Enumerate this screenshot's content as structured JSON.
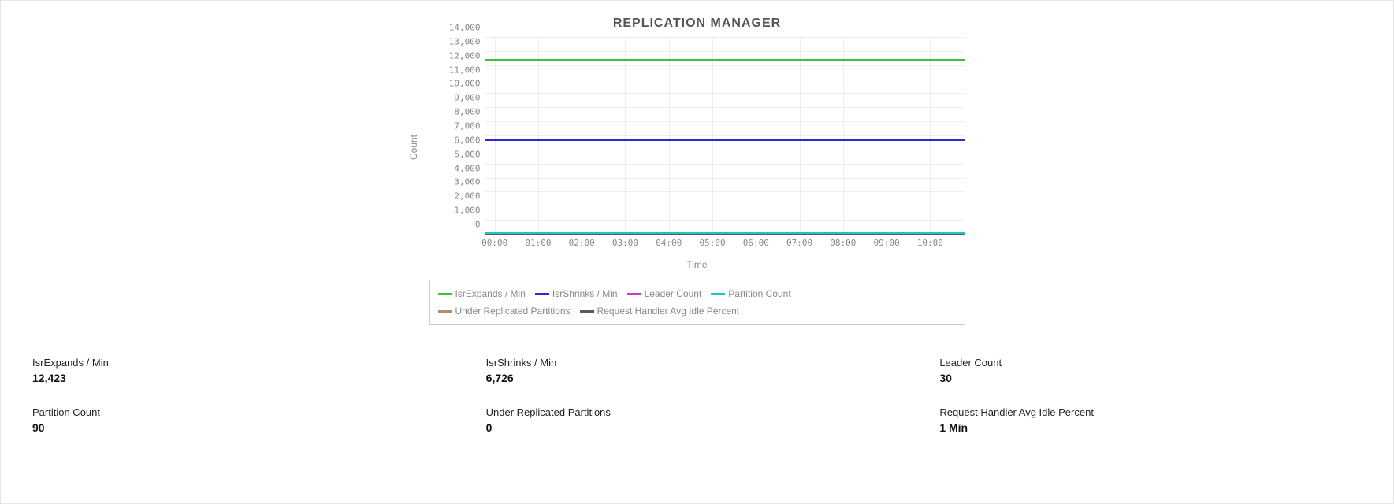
{
  "title": "REPLICATION MANAGER",
  "ylabel": "Count",
  "xlabel": "Time",
  "yticks": [
    "0",
    "1,000",
    "2,000",
    "3,000",
    "4,000",
    "5,000",
    "6,000",
    "7,000",
    "8,000",
    "9,000",
    "10,000",
    "11,000",
    "12,000",
    "13,000",
    "14,000"
  ],
  "xticks": [
    "00:00",
    "01:00",
    "02:00",
    "03:00",
    "04:00",
    "05:00",
    "06:00",
    "07:00",
    "08:00",
    "09:00",
    "10:00"
  ],
  "legend": [
    {
      "name": "IsrExpands / Min",
      "color": "#3fbf3f"
    },
    {
      "name": "IsrShrinks / Min",
      "color": "#2a2ad4"
    },
    {
      "name": "Leader Count",
      "color": "#d633c2"
    },
    {
      "name": "Partition Count",
      "color": "#20c6c6"
    },
    {
      "name": "Under Replicated Partitions",
      "color": "#b88b70"
    },
    {
      "name": "Request Handler Avg Idle Percent",
      "color": "#5a5a5a"
    }
  ],
  "stats": [
    {
      "label": "IsrExpands / Min",
      "value": "12,423"
    },
    {
      "label": "IsrShrinks / Min",
      "value": "6,726"
    },
    {
      "label": "Leader Count",
      "value": "30"
    },
    {
      "label": "Partition Count",
      "value": "90"
    },
    {
      "label": "Under Replicated Partitions",
      "value": "0"
    },
    {
      "label": "Request Handler Avg Idle Percent",
      "value": "1 Min"
    }
  ],
  "chart_data": {
    "type": "line",
    "title": "REPLICATION MANAGER",
    "xlabel": "Time",
    "ylabel": "Count",
    "ylim": [
      0,
      14000
    ],
    "x": [
      "00:00",
      "01:00",
      "02:00",
      "03:00",
      "04:00",
      "05:00",
      "06:00",
      "07:00",
      "08:00",
      "09:00",
      "10:00"
    ],
    "series": [
      {
        "name": "IsrExpands / Min",
        "color": "#3fbf3f",
        "values": [
          12423,
          12423,
          12423,
          12423,
          12423,
          12423,
          12423,
          12423,
          12423,
          12423,
          12423
        ]
      },
      {
        "name": "IsrShrinks / Min",
        "color": "#2a2ad4",
        "values": [
          6726,
          6726,
          6726,
          6726,
          6726,
          6726,
          6726,
          6726,
          6726,
          6726,
          6726
        ]
      },
      {
        "name": "Leader Count",
        "color": "#d633c2",
        "values": [
          30,
          30,
          30,
          30,
          30,
          30,
          30,
          30,
          30,
          30,
          30
        ]
      },
      {
        "name": "Partition Count",
        "color": "#20c6c6",
        "values": [
          90,
          90,
          90,
          90,
          90,
          90,
          90,
          90,
          90,
          90,
          90
        ]
      },
      {
        "name": "Under Replicated Partitions",
        "color": "#b88b70",
        "values": [
          0,
          0,
          0,
          0,
          0,
          0,
          0,
          0,
          0,
          0,
          0
        ]
      },
      {
        "name": "Request Handler Avg Idle Percent",
        "color": "#5a5a5a",
        "values": [
          1,
          1,
          1,
          1,
          1,
          1,
          1,
          1,
          1,
          1,
          1
        ]
      }
    ]
  }
}
